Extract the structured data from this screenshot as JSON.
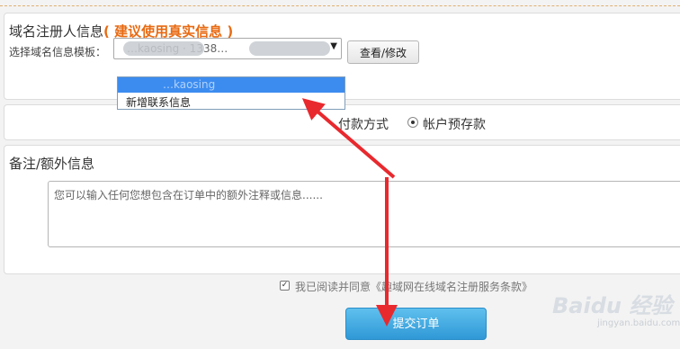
{
  "registrant": {
    "title": "域名注册人信息",
    "title_accent": "( 建议使用真实信息 )",
    "template_label": "选择域名信息模板：",
    "select_value": "…kaosing · 1338…",
    "view_button": "查看/修改",
    "dropdown": {
      "selected": "…kaosing",
      "new_option": "新增联系信息"
    }
  },
  "payment": {
    "label": "付款方式",
    "option": "帐户预存款"
  },
  "notes": {
    "title": "备注/额外信息",
    "placeholder": "您可以输入任何您想包含在订单中的额外注释或信息......"
  },
  "agreement": {
    "text": "我已阅读并同意",
    "link": "《趣域网在线域名注册服务条款》"
  },
  "submit_label": "提交订单",
  "watermark": {
    "main": "Baidu 经验",
    "sub": "jingyan.baidu.com"
  },
  "colors": {
    "accent": "#e86a12",
    "arrow": "#e8292e",
    "submit": "#2f98d6",
    "highlight": "#3c8cf0"
  }
}
